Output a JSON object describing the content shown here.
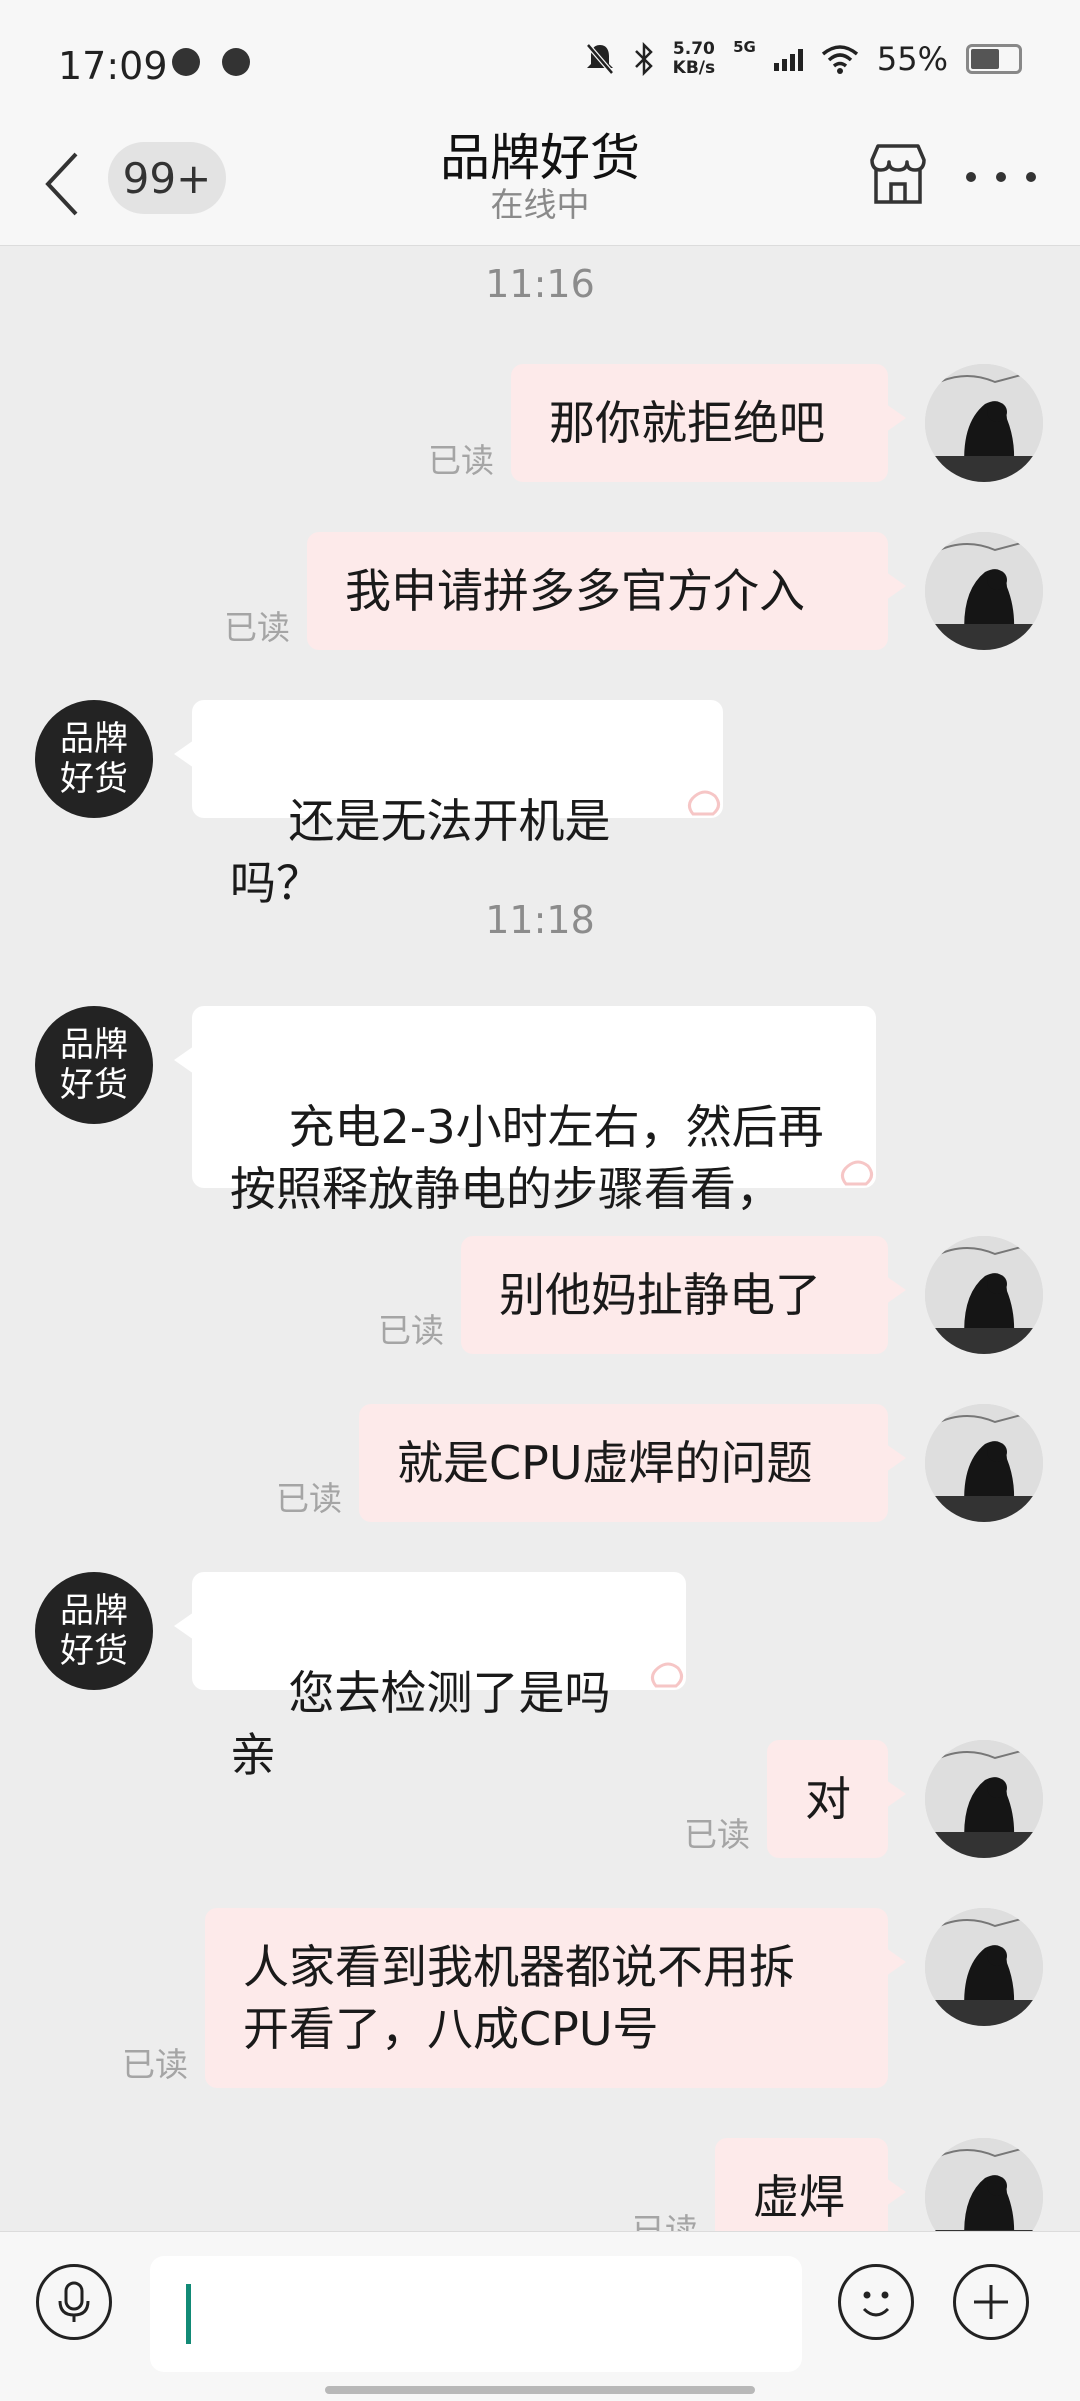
{
  "status_bar": {
    "time": "17:09",
    "speed_value": "5.70",
    "speed_unit": "KB/s",
    "network": "5G",
    "battery": "55%",
    "battery_level": 0.55,
    "icons": [
      "globe-icon",
      "timer-icon",
      "mute-icon",
      "bluetooth-icon",
      "signal-icon",
      "wifi-icon",
      "battery-icon"
    ]
  },
  "header": {
    "unread_badge": "99+",
    "title": "品牌好货",
    "subtitle": "在线中"
  },
  "shop_avatar_text": "品牌好货",
  "messages": [
    {
      "type": "timestamp",
      "text": "11:16"
    },
    {
      "type": "out",
      "text": "那你就拒绝吧",
      "read": "已读"
    },
    {
      "type": "out",
      "text": "我申请拼多多官方介入",
      "read": "已读"
    },
    {
      "type": "in",
      "text": "还是无法开机是吗？"
    },
    {
      "type": "timestamp",
      "text": "11:18"
    },
    {
      "type": "in",
      "text": "充电2-3小时左右，然后再\n按照释放静电的步骤看看，"
    },
    {
      "type": "out",
      "text": "别他妈扯静电了",
      "read": "已读"
    },
    {
      "type": "out",
      "text": "就是CPU虚焊的问题",
      "read": "已读"
    },
    {
      "type": "in",
      "text": "您去检测了是吗 亲"
    },
    {
      "type": "out",
      "text": "对",
      "read": "已读"
    },
    {
      "type": "out",
      "text": "人家看到我机器都说不用拆\n开看了，八成CPU号",
      "read": "已读"
    },
    {
      "type": "out",
      "text": "虚焊",
      "read": "已读"
    }
  ],
  "input": {
    "value": "",
    "placeholder": ""
  },
  "colors": {
    "out_bubble": "#fdeaea",
    "in_bubble": "#ffffff",
    "background": "#ededed",
    "caret": "#128a76"
  }
}
